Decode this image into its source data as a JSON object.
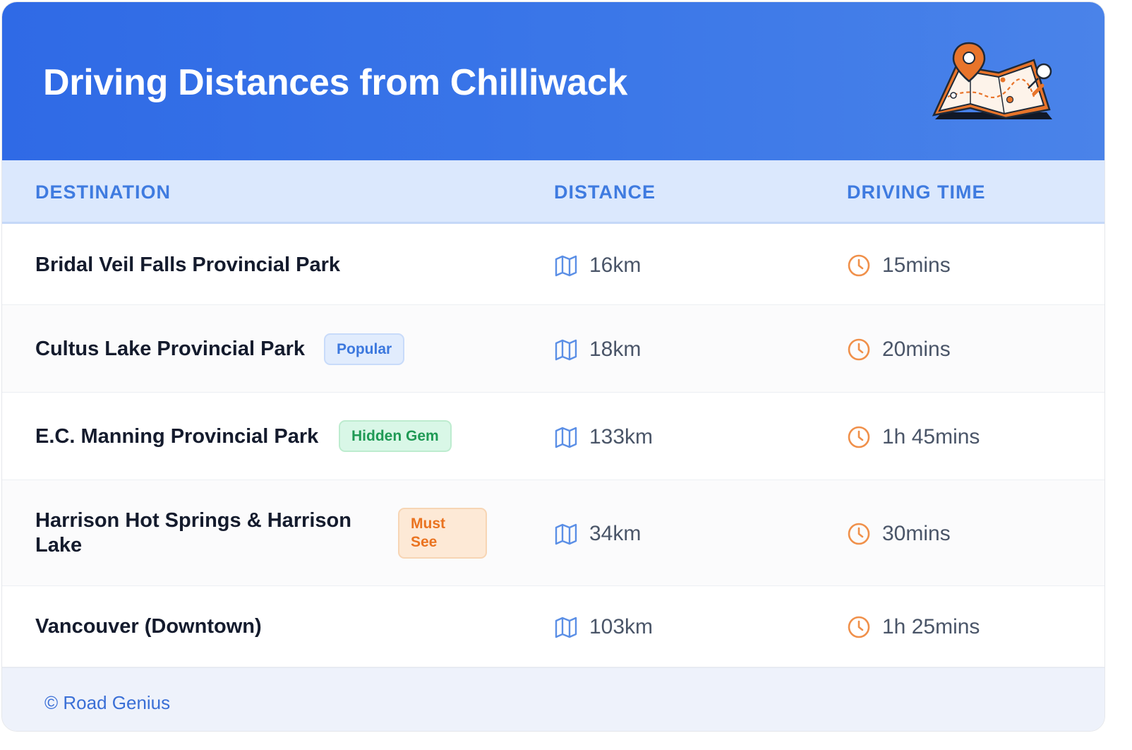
{
  "header": {
    "title": "Driving Distances from Chilliwack",
    "illustration_icon": "map-pin-illustration"
  },
  "table": {
    "columns": [
      "DESTINATION",
      "DISTANCE",
      "DRIVING TIME"
    ],
    "rows": [
      {
        "destination": "Bridal Veil Falls Provincial Park",
        "badge": "",
        "distance": "16km",
        "time": "15mins"
      },
      {
        "destination": "Cultus Lake Provincial Park",
        "badge": "Popular",
        "distance": "18km",
        "time": "20mins"
      },
      {
        "destination": "E.C. Manning Provincial Park",
        "badge": "Hidden Gem",
        "distance": "133km",
        "time": "1h 45mins"
      },
      {
        "destination": "Harrison Hot Springs & Harrison Lake",
        "badge": "Must See",
        "distance": "34km",
        "time": "30mins"
      },
      {
        "destination": "Vancouver (Downtown)",
        "badge": "",
        "distance": "103km",
        "time": "1h 25mins"
      }
    ]
  },
  "icons": {
    "distance": "map-icon",
    "time": "clock-icon"
  },
  "colors": {
    "header": "#2f6ae6",
    "column_header_text": "#3f7be0",
    "badge_popular": "#3c78de",
    "badge_hidden_gem": "#1f9a55",
    "badge_must_see": "#ea7320",
    "clock": "#f0904a",
    "map": "#5b8fe6"
  },
  "footer": {
    "credit": "© Road Genius"
  }
}
